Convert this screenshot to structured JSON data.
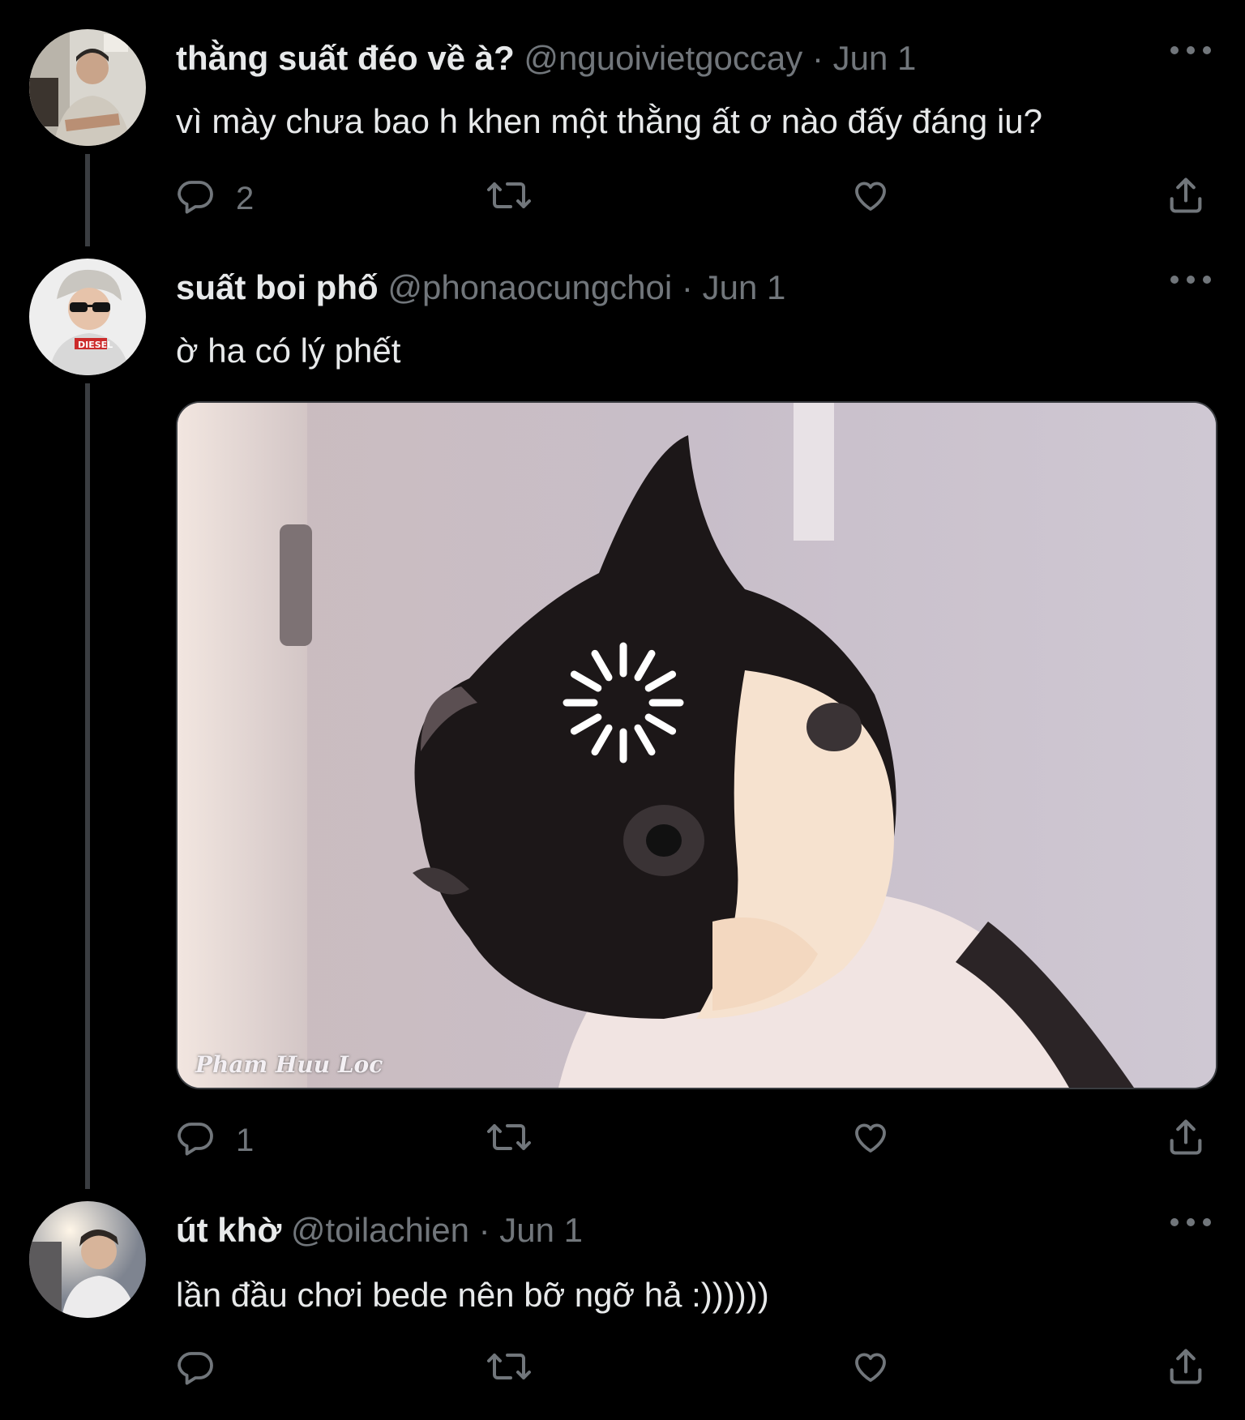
{
  "tweets": [
    {
      "name": "thằng suất đéo về à?",
      "handle": "@nguoivietgoccay",
      "separator": "·",
      "date": "Jun 1",
      "text": "vì mày chưa bao h khen một thằng ất ơ nào đấy đáng iu?",
      "reply_count": "2",
      "avatar": "avatar-photo"
    },
    {
      "name": "suất boi phố",
      "handle": "@phonaocungchoi",
      "separator": "·",
      "date": "Jun 1",
      "text": "ờ ha có lý phết",
      "reply_count": "1",
      "avatar": "avatar-photo",
      "media": {
        "watermark": "Pham Huu Loc",
        "state": "loading"
      }
    },
    {
      "name": "út khờ",
      "handle": "@toilachien",
      "separator": "·",
      "date": "Jun 1",
      "text": "lần đầu chơi bede nên bỡ ngỡ hả :))))))",
      "reply_count": "",
      "avatar": "avatar-photo"
    }
  ],
  "icons": {
    "reply": "reply-icon",
    "retweet": "retweet-icon",
    "like": "heart-icon",
    "share": "share-icon",
    "more": "more-icon",
    "loading": "loading-spinner-icon"
  },
  "colors": {
    "background": "#000000",
    "text_primary": "#e7e9ea",
    "text_secondary": "#71767b",
    "thread_line": "#3a3d41"
  }
}
